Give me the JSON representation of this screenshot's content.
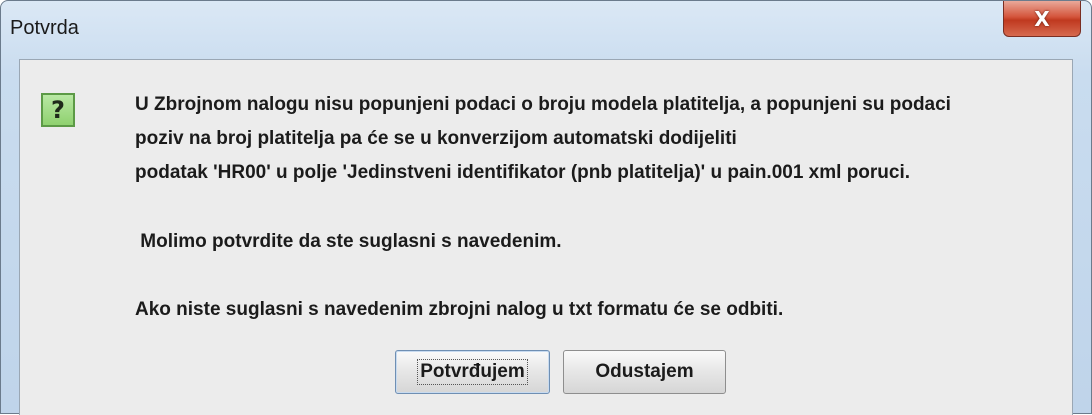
{
  "window": {
    "title": "Potvrda",
    "close_glyph": "X"
  },
  "dialog": {
    "icon": "question-icon",
    "icon_glyph": "?",
    "icon_color": "#8fd16f",
    "message_lines": [
      "U Zbrojnom nalogu nisu popunjeni podaci o broju modela platitelja, a popunjeni su podaci",
      "poziv na broj platitelja pa će se u konverzijom automatski dodijeliti",
      "podatak 'HR00' u polje 'Jedinstveni identifikator (pnb platitelja)' u pain.001 xml poruci.",
      " Molimo potvrdite da ste suglasni s navedenim.",
      "Ako niste suglasni s navedenim zbrojni nalog u txt formatu će se odbiti."
    ]
  },
  "buttons": {
    "confirm_label": "Potvrđujem",
    "cancel_label": "Odustajem"
  }
}
